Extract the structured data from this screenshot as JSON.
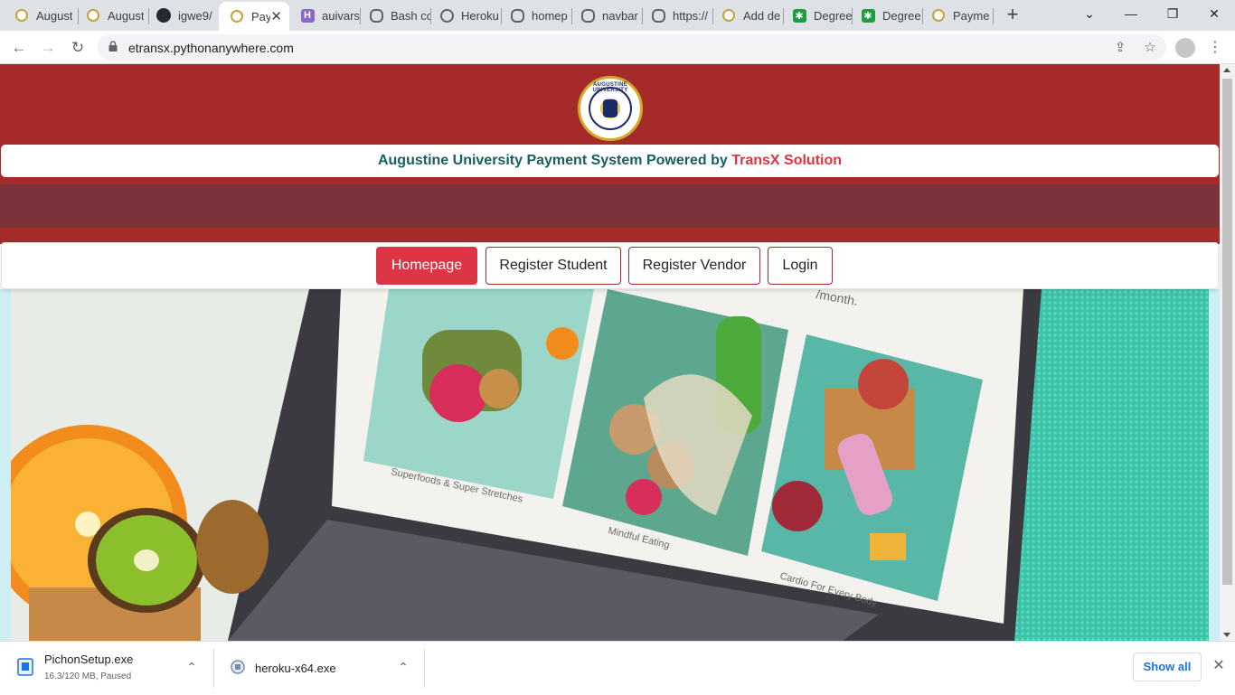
{
  "browser": {
    "tabs": [
      {
        "title": "August",
        "icon": "seal-icon"
      },
      {
        "title": "August",
        "icon": "seal-icon"
      },
      {
        "title": "igwe9/",
        "icon": "github-icon"
      },
      {
        "title": "Pay",
        "icon": "seal-icon",
        "active": true
      },
      {
        "title": "auivars",
        "icon": "heroku-icon"
      },
      {
        "title": "Bash cc",
        "icon": "pythonanywhere-icon"
      },
      {
        "title": "Heroku",
        "icon": "globe-icon"
      },
      {
        "title": "homep",
        "icon": "pythonanywhere-icon"
      },
      {
        "title": "navbar",
        "icon": "pythonanywhere-icon"
      },
      {
        "title": "https://",
        "icon": "pythonanywhere-icon"
      },
      {
        "title": "Add de",
        "icon": "seal-icon"
      },
      {
        "title": "Degree",
        "icon": "green-app-icon"
      },
      {
        "title": "Degree",
        "icon": "green-app-icon"
      },
      {
        "title": "Payme",
        "icon": "seal-icon"
      }
    ],
    "active_tab_close": "✕",
    "new_tab": "+",
    "window_controls": {
      "dropdown": "⌄",
      "minimize": "—",
      "maximize": "❐",
      "close": "✕"
    },
    "url": "etransx.pythonanywhere.com",
    "nav": {
      "back": "←",
      "forward": "→",
      "reload": "↻"
    },
    "omnibox_icons": {
      "share": "⇪",
      "bookmark": "☆"
    },
    "menu": "⋮"
  },
  "page": {
    "seal_text": "AUGUSTINE UNIVERSITY",
    "tagline_main": "Augustine University Payment System Powered by",
    "tagline_brand": "TransX Solution",
    "nav_buttons": [
      "Homepage",
      "Register Student",
      "Register Vendor",
      "Login"
    ],
    "hero_captions": [
      "Superfoods & Super Stretches",
      "Mindful Eating",
      "Cardio For Every Body",
      "/month."
    ],
    "colors": {
      "banner": "#a52a2a",
      "band": "#7b3238",
      "primary": "#dc3545",
      "tagline": "#155e63"
    }
  },
  "downloads": {
    "items": [
      {
        "name": "PichonSetup.exe",
        "status": "16.3/120 MB, Paused"
      },
      {
        "name": "heroku-x64.exe",
        "status": ""
      }
    ],
    "chevron": "⌃",
    "show_all": "Show all",
    "close": "✕"
  }
}
